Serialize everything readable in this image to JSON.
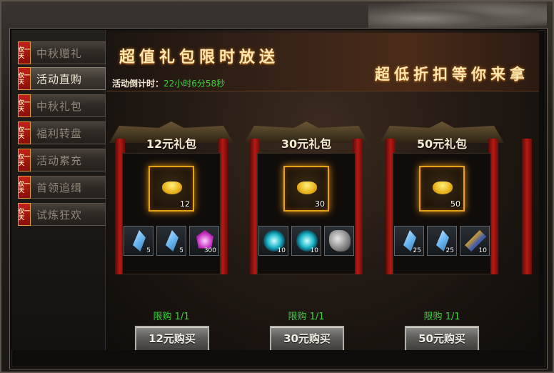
{
  "sidebar": {
    "tag": "仅一天",
    "items": [
      {
        "label": "中秋赠礼",
        "active": false
      },
      {
        "label": "活动直购",
        "active": true
      },
      {
        "label": "中秋礼包",
        "active": false
      },
      {
        "label": "福利转盘",
        "active": false
      },
      {
        "label": "活动累充",
        "active": false
      },
      {
        "label": "首领追缉",
        "active": false
      },
      {
        "label": "试炼狂欢",
        "active": false
      }
    ]
  },
  "banner": {
    "title1": "超值礼包限时放送",
    "title2": "超低折扣等你来拿",
    "countdown_label": "活动倒计时：",
    "countdown_value": "22小时6分58秒"
  },
  "packs": [
    {
      "name": "12元礼包",
      "main_count": "12",
      "items": [
        {
          "icon": "crystal-icon",
          "count": "5"
        },
        {
          "icon": "crystal-icon",
          "count": "5"
        },
        {
          "icon": "gem-icon",
          "count": "300"
        }
      ],
      "limit": "限购 1/1",
      "button": "12元购买"
    },
    {
      "name": "30元礼包",
      "main_count": "30",
      "items": [
        {
          "icon": "orb-icon",
          "count": "10"
        },
        {
          "icon": "orb-icon",
          "count": "10"
        },
        {
          "icon": "ore-icon",
          "count": ""
        }
      ],
      "limit": "限购 1/1",
      "button": "30元购买"
    },
    {
      "name": "50元礼包",
      "main_count": "50",
      "items": [
        {
          "icon": "crystal-icon",
          "count": "25"
        },
        {
          "icon": "crystal-icon",
          "count": "25"
        },
        {
          "icon": "scroll-icon",
          "count": "10"
        }
      ],
      "limit": "限购 1/1",
      "button": "50元购买"
    }
  ],
  "colors": {
    "gold": "#e8a21a",
    "green": "#3ed23e",
    "curtain": "#b51a12"
  }
}
